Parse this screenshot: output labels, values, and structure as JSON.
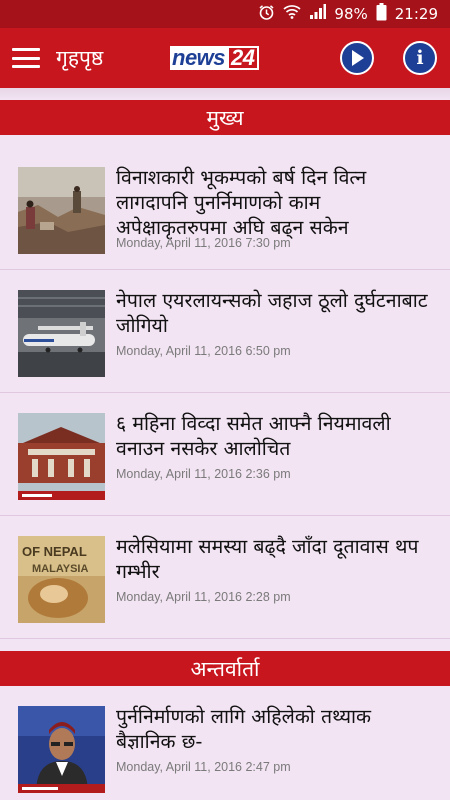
{
  "status_bar": {
    "battery": "98%",
    "time": "21:29"
  },
  "app_bar": {
    "title": "गृहपृष्ठ",
    "logo_text": "news",
    "logo_num": "24",
    "info_label": "i"
  },
  "sections": [
    {
      "title": "मुख्य",
      "articles": [
        {
          "headline": "विनाशकारी भूकम्पको बर्ष दिन वित्न लागदापनि पुनर्निमाणको काम अपेक्षाकृतरुपमा अघि बढ्न सकेन",
          "date": "Monday, April 11, 2016 7:30 pm"
        },
        {
          "headline": "नेपाल एयरलायन्सको जहाज ठूलो दुर्घटनाबाट जोगियो",
          "date": "Monday, April 11, 2016 6:50 pm"
        },
        {
          "headline": "६ महिना विव्दा समेत आफ्नै नियमावली वनाउन नसकेर आलोचित",
          "date": "Monday, April 11, 2016 2:36 pm"
        },
        {
          "headline": "मलेसियामा समस्या बढ्दै जाँदा दूतावास थप गम्भीर",
          "date": "Monday, April 11, 2016 2:28 pm"
        }
      ]
    },
    {
      "title": "अन्तर्वार्ता",
      "articles": [
        {
          "headline": "पुर्ननिर्माणको लागि अहिलेको तथ्याक बैज्ञानिक छ-",
          "date": "Monday, April 11, 2016 2:47 pm"
        }
      ]
    }
  ],
  "thumb_text": {
    "nepal_sign": "OF NEPAL",
    "malaysia_sign": "MALAYSIA"
  },
  "colors": {
    "brand_red": "#c8161f",
    "status_red": "#a5121a",
    "logo_blue": "#1d3f95",
    "background": "#f3e4f3"
  }
}
